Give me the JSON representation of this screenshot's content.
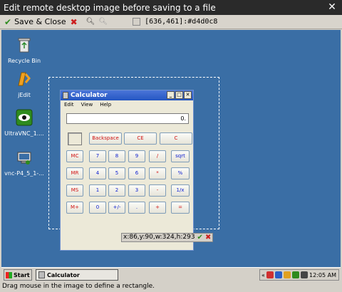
{
  "window": {
    "title": "Edit remote desktop image before saving to a file",
    "close_icon": "close-icon"
  },
  "toolbar": {
    "save_label": "Save & Close",
    "coord_readout": "[636,461]:#d4d0c8",
    "swatch_color": "#d4d0c8"
  },
  "desktop": {
    "icons": [
      {
        "label": "Recycle Bin",
        "icon": "recycle-bin-icon"
      },
      {
        "label": "jEdit",
        "icon": "jedit-icon"
      },
      {
        "label": "UltraVNC_1....",
        "icon": "eye-icon"
      },
      {
        "label": "vnc-P4_5_1-...",
        "icon": "installer-icon"
      }
    ]
  },
  "calculator": {
    "title": "Calculator",
    "menu": [
      "Edit",
      "View",
      "Help"
    ],
    "display": "0.",
    "buttons": {
      "backspace": "Backspace",
      "ce": "CE",
      "c": "C",
      "mc": "MC",
      "mr": "MR",
      "ms": "MS",
      "mplus": "M+",
      "n7": "7",
      "n8": "8",
      "n9": "9",
      "div": "/",
      "sqrt": "sqrt",
      "n4": "4",
      "n5": "5",
      "n6": "6",
      "mul": "*",
      "pct": "%",
      "n1": "1",
      "n2": "2",
      "n3": "3",
      "sub": "-",
      "inv": "1/x",
      "n0": "0",
      "sign": "+/-",
      "dot": ".",
      "add": "+",
      "eq": "="
    }
  },
  "selection": {
    "label": "x:86,y:90,w:324,h:293"
  },
  "taskbar": {
    "start": "Start",
    "task": "Calculator",
    "time": "12:05 AM",
    "tray_chevron": "«"
  },
  "status": {
    "text": "Drag mouse in the image to define a rectangle."
  }
}
